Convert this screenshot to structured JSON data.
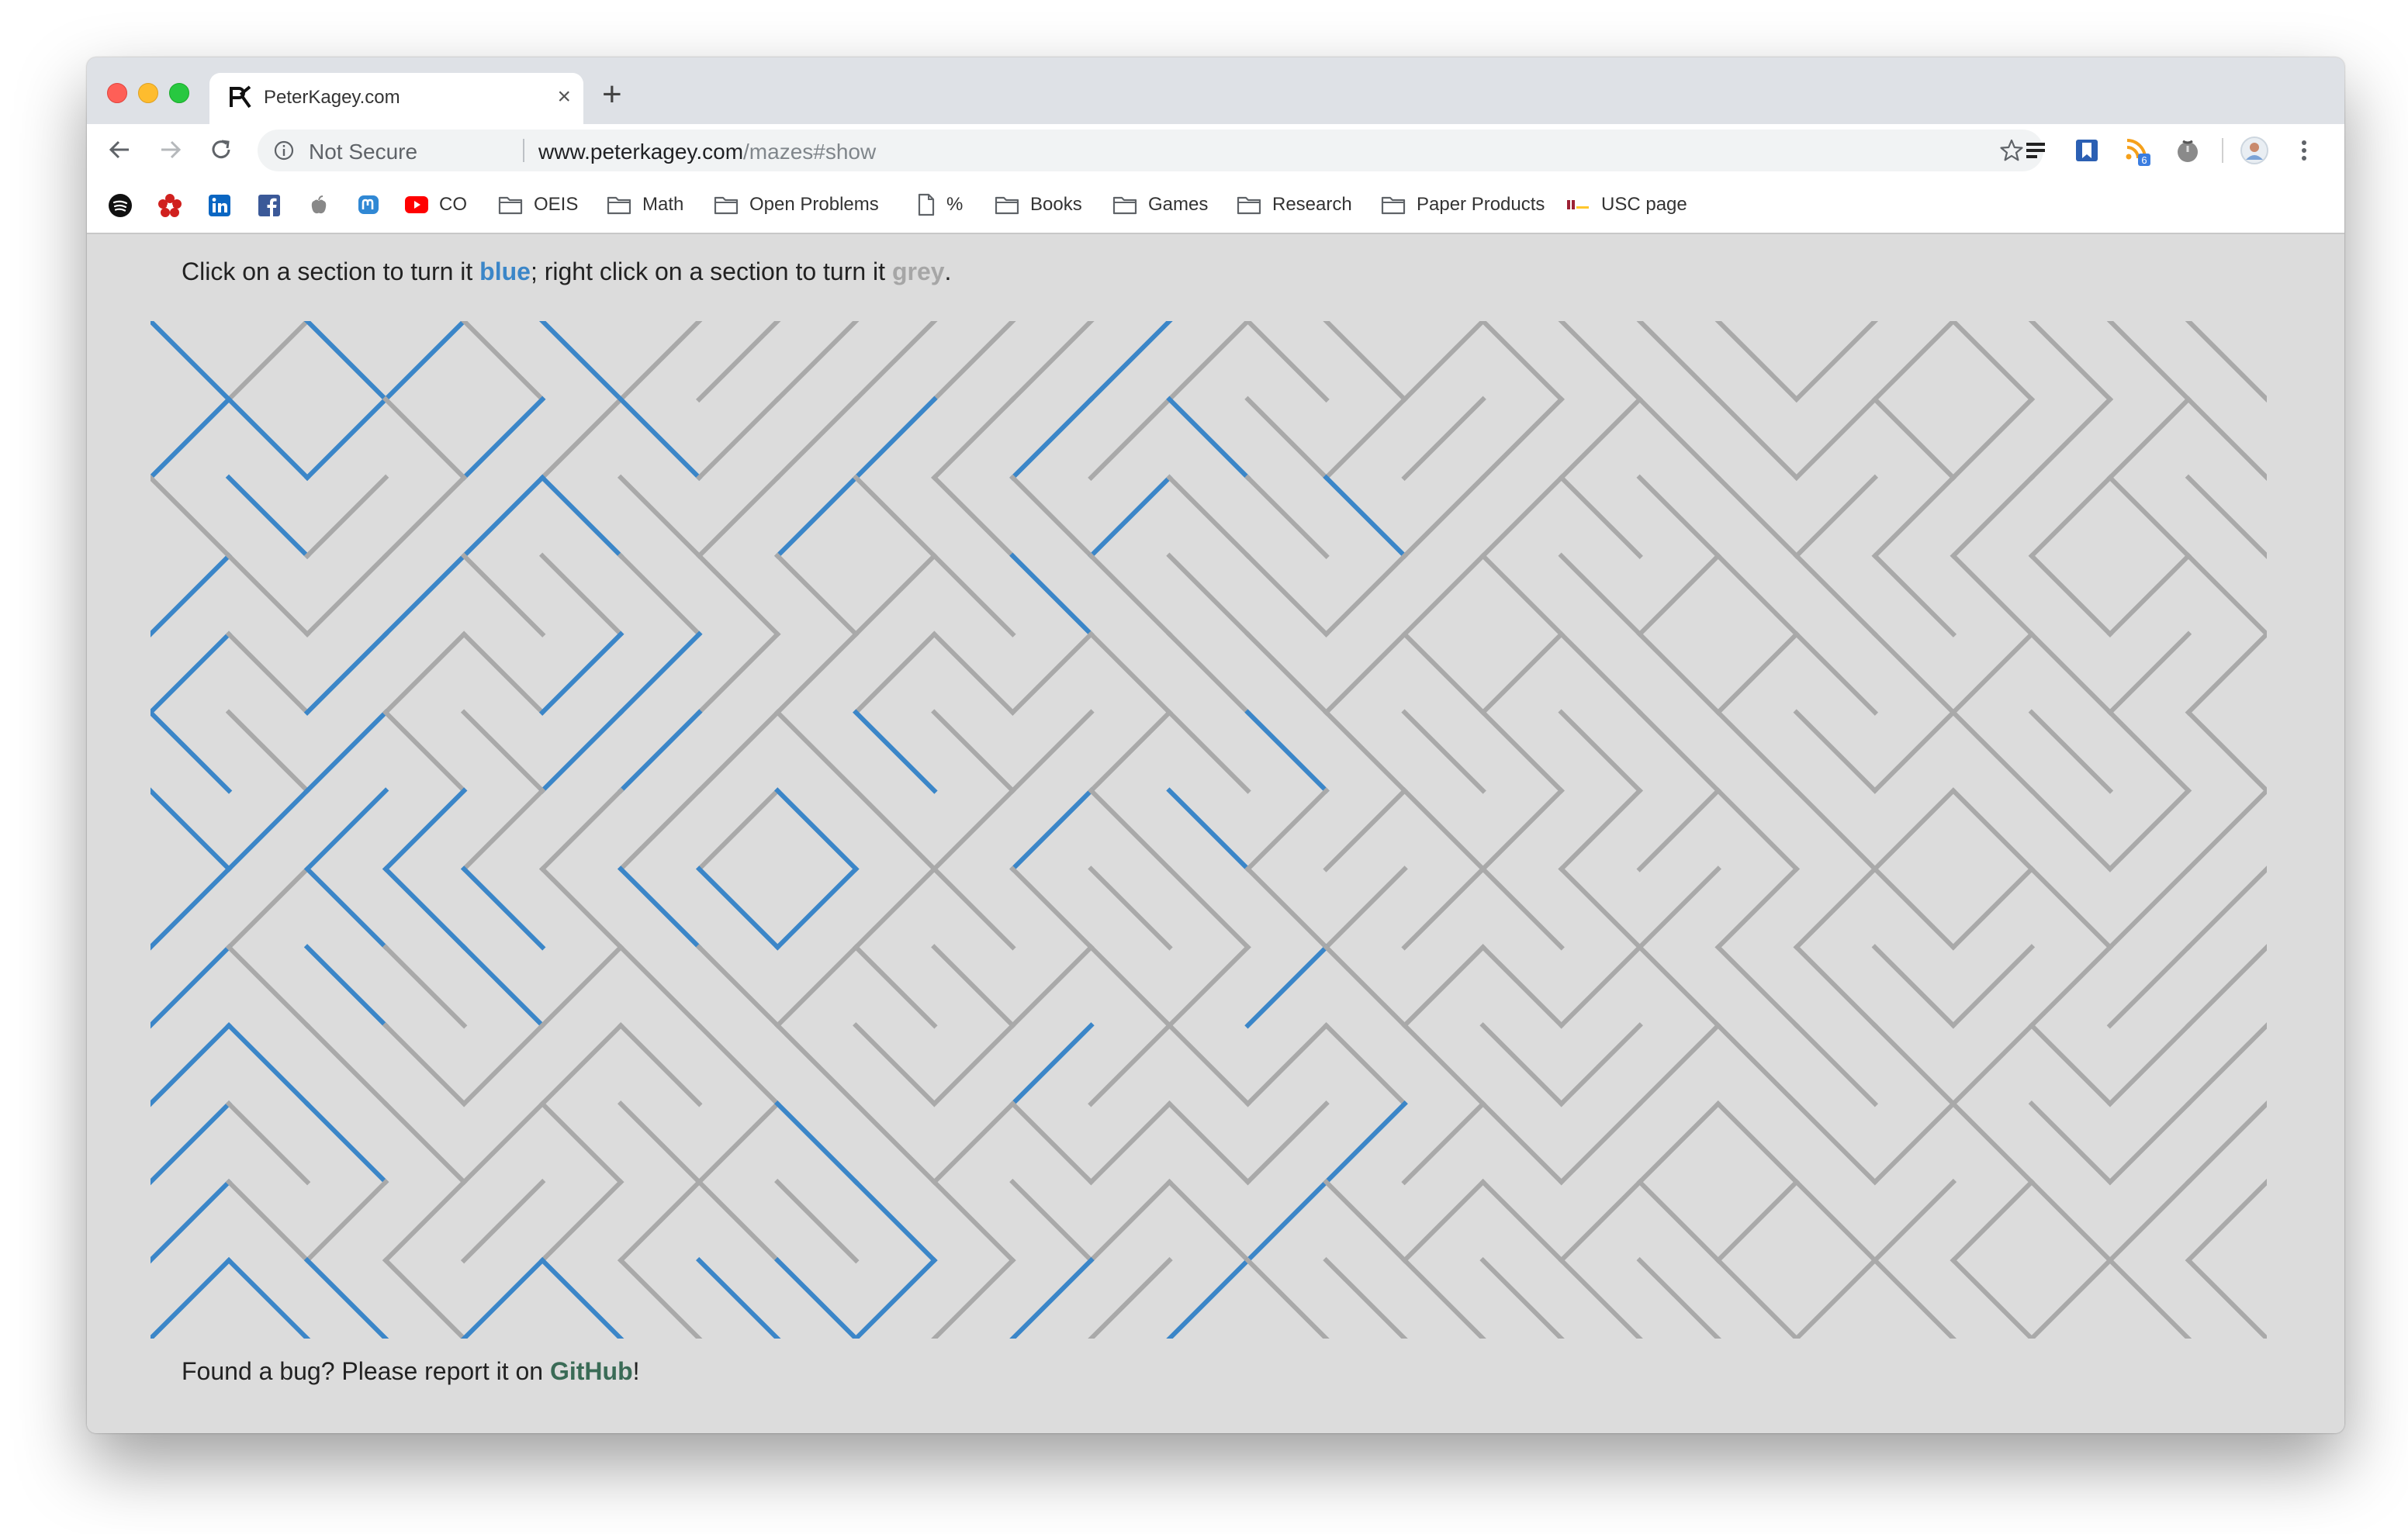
{
  "tab": {
    "title": "PeterKagey.com",
    "close": "×",
    "new_tab": "+"
  },
  "address_bar": {
    "security": "Not Secure",
    "host": "www.peterkagey.com",
    "path": "/mazes#show"
  },
  "extensions": {
    "rss_badge": "6"
  },
  "bookmarks": [
    {
      "label": "CO",
      "icon": "youtube-icon"
    },
    {
      "label": "OEIS",
      "icon": "folder-icon"
    },
    {
      "label": "Math",
      "icon": "folder-icon"
    },
    {
      "label": "Open Problems",
      "icon": "folder-icon"
    },
    {
      "label": "%",
      "icon": "page-icon"
    },
    {
      "label": "Books",
      "icon": "folder-icon"
    },
    {
      "label": "Games",
      "icon": "folder-icon"
    },
    {
      "label": "Research",
      "icon": "folder-icon"
    },
    {
      "label": "Paper Products",
      "icon": "folder-icon"
    },
    {
      "label": "USC page",
      "icon": "usc-icon"
    }
  ],
  "instructions": {
    "prefix": "Click on a section to turn it ",
    "blue_word": "blue",
    "middle": "; right click on a section to turn it ",
    "grey_word": "grey",
    "suffix": "."
  },
  "footer": {
    "prefix": "Found a bug? Please report it on ",
    "link": "GitHub",
    "suffix": "!"
  },
  "maze": {
    "colors": {
      "grey": "#a9a9a9",
      "blue": "#3b86c8"
    },
    "rows": 13,
    "cols": 27,
    "blue_sections": 70
  }
}
